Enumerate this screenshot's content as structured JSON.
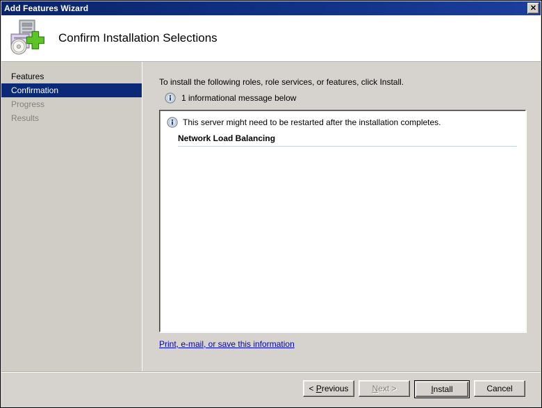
{
  "window": {
    "title": "Add Features Wizard",
    "close_label": "✕",
    "close_icon": "close-icon"
  },
  "header": {
    "title": "Confirm Installation Selections",
    "icon": "add-features-server-icon"
  },
  "sidebar": {
    "items": [
      {
        "label": "Features",
        "state": "visited"
      },
      {
        "label": "Confirmation",
        "state": "selected"
      },
      {
        "label": "Progress",
        "state": "upcoming"
      },
      {
        "label": "Results",
        "state": "upcoming"
      }
    ]
  },
  "main": {
    "intro_text": "To install the following roles, role services, or features, click Install.",
    "message_count_text": "1 informational message below",
    "message_icon": "information-icon",
    "panel": {
      "message_icon": "information-icon",
      "message": "This server might need to be restarted after the installation completes.",
      "heading": "Network Load Balancing"
    },
    "save_link": "Print, e-mail, or save this information"
  },
  "footer": {
    "buttons": [
      {
        "name": "previous-button",
        "prefix": "< ",
        "accel": "P",
        "suffix": "revious",
        "state": "enabled",
        "style": "normal"
      },
      {
        "name": "next-button",
        "prefix": "",
        "accel": "N",
        "suffix": "ext >",
        "state": "disabled",
        "style": "normal"
      },
      {
        "name": "install-button",
        "prefix": "",
        "accel": "I",
        "suffix": "nstall",
        "state": "enabled",
        "style": "default"
      },
      {
        "name": "cancel-button",
        "prefix": "",
        "accel": "",
        "suffix": "Cancel",
        "state": "enabled",
        "style": "normal"
      }
    ]
  },
  "colors": {
    "titlebar": "#0a246a",
    "selection": "#0a2a78",
    "dialog_face": "#d6d3ce",
    "sidebar_face": "#d0cdc7",
    "link": "#0000cd",
    "disabled_text": "#848278"
  }
}
